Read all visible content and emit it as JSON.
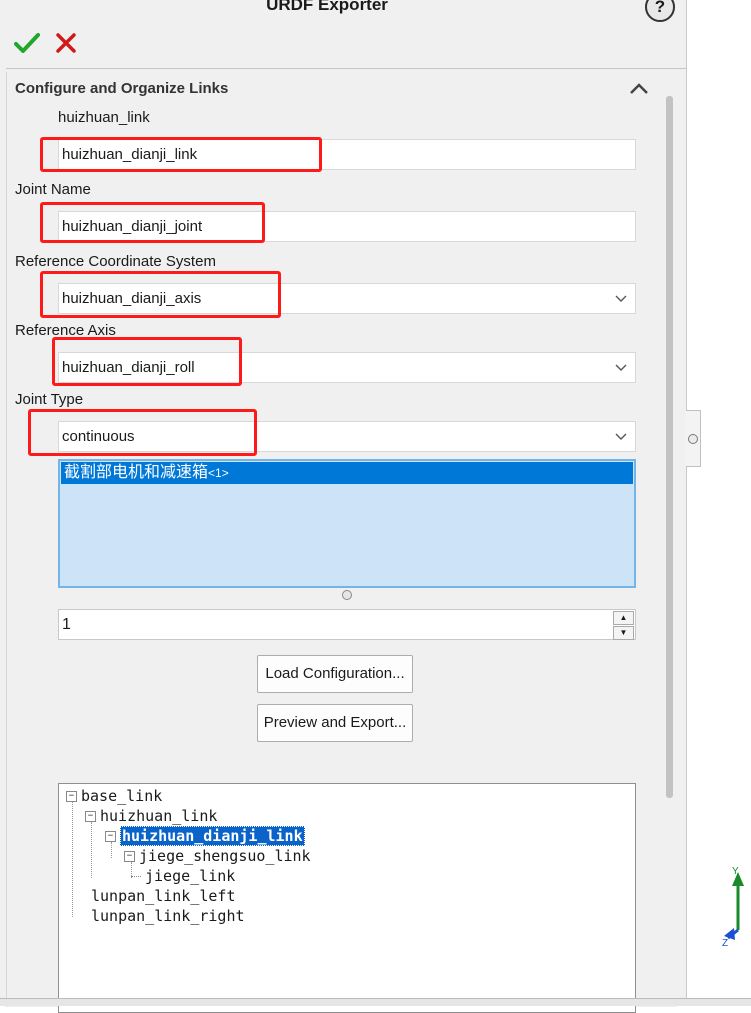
{
  "header": {
    "title": "URDF Exporter",
    "help_icon": "question-mark-icon"
  },
  "actions": {
    "ok_icon": "green-checkmark-icon",
    "cancel_icon": "red-x-icon"
  },
  "section": {
    "title": "Configure and Organize Links",
    "collapse_icon": "chevron-up-icon"
  },
  "form": {
    "link_parent_label": "huizhuan_link",
    "link_name_value": "huizhuan_dianji_link",
    "joint_name_label": "Joint Name",
    "joint_name_value": "huizhuan_dianji_joint",
    "ref_coord_label": "Reference Coordinate System",
    "ref_coord_value": "huizhuan_dianji_axis",
    "ref_axis_label": "Reference Axis",
    "ref_axis_value": "huizhuan_dianji_roll",
    "joint_type_label": "Joint Type",
    "joint_type_value": "continuous"
  },
  "components_list": {
    "items": [
      {
        "name": "截割部电机和减速箱",
        "suffix": "<1>"
      }
    ]
  },
  "spinner": {
    "value": "1"
  },
  "buttons": {
    "load_config": "Load Configuration...",
    "preview_export": "Preview and Export..."
  },
  "tree": {
    "nodes": [
      {
        "label": "base_link",
        "expander": "−"
      },
      {
        "label": "huizhuan_link",
        "expander": "−"
      },
      {
        "label": "huizhuan_dianji_link",
        "expander": "−",
        "selected": true
      },
      {
        "label": "jiege_shengsuo_link",
        "expander": "−"
      },
      {
        "label": "jiege_link"
      },
      {
        "label": "lunpan_link_left"
      },
      {
        "label": "lunpan_link_right"
      }
    ]
  },
  "viewport": {
    "axis_y_label": "Y",
    "axis_z_label": "Z",
    "colors": {
      "y_axis": "#1a8a2a",
      "z_axis": "#1b4fd6"
    }
  },
  "highlight_color": "#ff1a1a",
  "selection_color": "#0078d7"
}
